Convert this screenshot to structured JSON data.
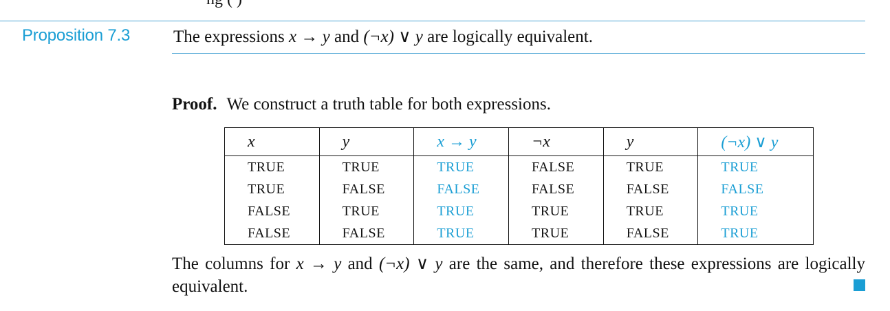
{
  "clipped_top_text": "ng (                    )",
  "proposition": {
    "label": "Proposition 7.3",
    "text_prefix": "The expressions ",
    "expr1": "x → y",
    "text_mid": " and ",
    "expr2": "(¬x) ∨ y",
    "text_suffix": " are logically equivalent."
  },
  "proof": {
    "label": "Proof.",
    "text": "We construct a truth table for both expressions."
  },
  "table": {
    "headers": [
      "x",
      "y",
      "x → y",
      "¬x",
      "y",
      "(¬x) ∨ y"
    ],
    "highlight_columns": [
      2,
      5
    ],
    "rows": [
      [
        "TRUE",
        "TRUE",
        "TRUE",
        "FALSE",
        "TRUE",
        "TRUE"
      ],
      [
        "TRUE",
        "FALSE",
        "FALSE",
        "FALSE",
        "FALSE",
        "FALSE"
      ],
      [
        "FALSE",
        "TRUE",
        "TRUE",
        "TRUE",
        "TRUE",
        "TRUE"
      ],
      [
        "FALSE",
        "FALSE",
        "TRUE",
        "TRUE",
        "FALSE",
        "TRUE"
      ]
    ]
  },
  "conclusion": {
    "prefix": "The columns for ",
    "expr1": "x → y",
    "mid": " and ",
    "expr2": "(¬x) ∨ y",
    "suffix": " are the same, and therefore these expressions are logically equivalent."
  },
  "colors": {
    "accent": "#1a9ed4",
    "text": "#111111"
  },
  "icons": {
    "qed": "qed-square-icon"
  }
}
